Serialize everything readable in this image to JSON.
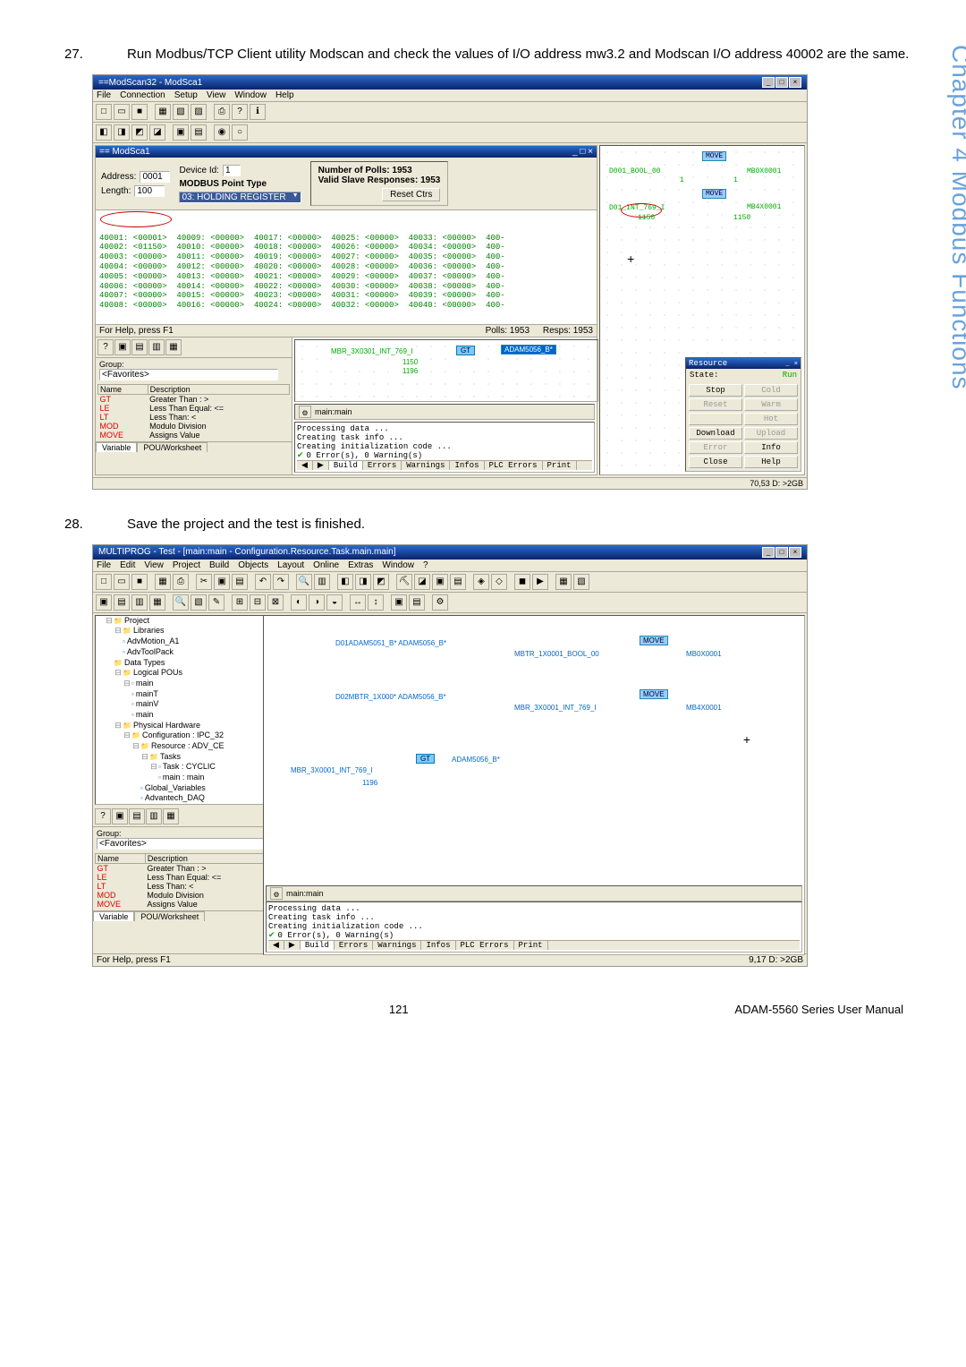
{
  "sideTab": "Chapter 4 Modbus Functions",
  "steps": {
    "s27_num": "27.",
    "s27_text": "Run Modbus/TCP Client utility Modscan and check the values of I/O address mw3.2 and Modscan I/O address 40002 are the same.",
    "s28_num": "28.",
    "s28_text": "Save the project and the test is finished."
  },
  "modscan": {
    "outerTitle": "==ModScan32 - ModSca1",
    "menus": [
      "File",
      "Connection",
      "Setup",
      "View",
      "Window",
      "Help"
    ],
    "innerTitle": "== ModSca1",
    "addrLabel": "Address:",
    "addrValue": "0001",
    "lenLabel": "Length:",
    "lenValue": "100",
    "devIdLabel": "Device Id:",
    "devIdValue": "1",
    "pointTypeLabel": "MODBUS Point Type",
    "pointType": "03: HOLDING REGISTER",
    "pollLabel": "Number of Polls: 1953",
    "slaveLabel": "Valid Slave Responses: 1953",
    "resetBtn": "Reset Ctrs",
    "registers": "40001: <00001>  40009: <00000>  40017: <00000>  40025: <00000>  40033: <00000>  400-\n40002: <01150>  40010: <00000>  40018: <00000>  40026: <00000>  40034: <00000>  400-\n40003: <00000>  40011: <00000>  40019: <00000>  40027: <00000>  40035: <00000>  400-\n40004: <00000>  40012: <00000>  40020: <00000>  40028: <00000>  40036: <00000>  400-\n40005: <00000>  40013: <00000>  40021: <00000>  40029: <00000>  40037: <00000>  400-\n40006: <00000>  40014: <00000>  40022: <00000>  40030: <00000>  40038: <00000>  400-\n40007: <00000>  40015: <00000>  40023: <00000>  40031: <00000>  40039: <00000>  400-\n40008: <00000>  40016: <00000>  40024: <00000>  40032: <00000>  40040: <00000>  400-",
    "helpStatus": "For Help, press F1",
    "pollsStat": "Polls: 1953",
    "respsStat": "Resps: 1953"
  },
  "diagram1": {
    "move1": "MOVE",
    "bool_sig": "D001_BOOL_00",
    "mb0x": "MB0X0001",
    "one1": "1",
    "one2": "1",
    "move2": "MOVE",
    "int_sig": "D01_INT_769_I",
    "mb4x": "MB4X0001",
    "v1150a": "1150",
    "v1150b": "1150"
  },
  "codeA": {
    "mbr": "MBR_3X0301_INT_769_I",
    "v1150": "1150",
    "v1196": "1196",
    "gt": "GT",
    "adam": "ADAM5056_B*"
  },
  "navPane": {
    "groupLabel": "Group:",
    "groupValue": "<Favorites>",
    "colName": "Name",
    "colDesc": "Description",
    "rows": [
      {
        "name": "GT",
        "desc": "Greater Than : >"
      },
      {
        "name": "LE",
        "desc": "Less Than Equal: <="
      },
      {
        "name": "LT",
        "desc": "Less Than: <"
      },
      {
        "name": "MOD",
        "desc": "Modulo Division"
      },
      {
        "name": "MOVE",
        "desc": "Assigns Value"
      }
    ],
    "varTab": "Variable",
    "pouTab": "POU/Worksheet"
  },
  "outputA": {
    "tabLabel": "main:main",
    "line1": "Processing data ...",
    "line2": "Creating task info ...",
    "line3": "Creating initialization code ...",
    "line4": "0 Error(s), 0 Warning(s)",
    "tabs": [
      "Build",
      "Errors",
      "Warnings",
      "Infos",
      "PLC Errors",
      "Print"
    ]
  },
  "sideCtrl": {
    "title": "Resource",
    "state": "State:",
    "run": "Run",
    "stop": "Stop",
    "cold": "Cold",
    "reset": "Reset",
    "warm": "Warm",
    "hot": "Hot",
    "download": "Download",
    "upload": "Upload",
    "error": "Error",
    "info": "Info",
    "close": "Close",
    "help": "Help"
  },
  "status1": "70,53  D: >2GB",
  "mp": {
    "title": "MULTIPROG - Test - [main:main - Configuration.Resource.Task.main.main]",
    "menus": [
      "File",
      "Edit",
      "View",
      "Project",
      "Build",
      "Objects",
      "Layout",
      "Online",
      "Extras",
      "Window",
      "?"
    ],
    "tree": {
      "root": "Project",
      "n1": "Libraries",
      "n1a": "AdvMotion_A1",
      "n1b": "AdvToolPack",
      "n2": "Data Types",
      "n3": "Logical POUs",
      "n3a": "main",
      "n3a1": "mainT",
      "n3a2": "mainV",
      "n3a3": "main",
      "n4": "Physical Hardware",
      "n4a": "Configuration : IPC_32",
      "n4b": "Resource : ADV_CE",
      "n4c": "Tasks",
      "n4d": "Task : CYCLIC",
      "n4e": "main : main",
      "n4f": "Global_Variables",
      "n4g": "Advantech_DAQ"
    },
    "diag": {
      "sig1": "D01ADAM5051_B* ADAM5056_B*",
      "mbtr1": "MBTR_1X0001_BOOL_00",
      "move": "MOVE",
      "mb0x": "MB0X0001",
      "sig2": "D02MBTR_1X000* ADAM5056_B*",
      "mbr3x": "MBR_3X0001_INT_769_I",
      "mb4x": "MB4X0001",
      "sig3": "MBR_3X0001_INT_769_I",
      "gt": "GT",
      "adam3": "ADAM5056_B*",
      "v1196": "1196"
    },
    "status": "9,17  D: >2GB"
  },
  "footer": {
    "pageNum": "121",
    "manual": "ADAM-5560 Series User Manual"
  }
}
